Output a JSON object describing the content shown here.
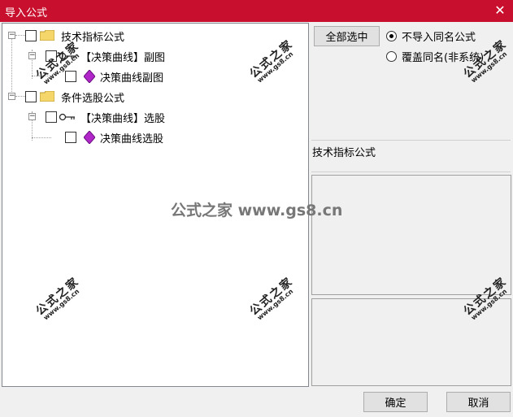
{
  "window": {
    "title": "导入公式",
    "close_glyph": "✕"
  },
  "tree": {
    "nodes": [
      {
        "label": "技术指标公式",
        "type": "folder",
        "expander": "−"
      },
      {
        "label": "【决策曲线】副图",
        "type": "key",
        "expander": "−"
      },
      {
        "label": "决策曲线副图",
        "type": "diamond"
      },
      {
        "label": "条件选股公式",
        "type": "folder",
        "expander": "−"
      },
      {
        "label": "【决策曲线】选股",
        "type": "key",
        "expander": "−"
      },
      {
        "label": "决策曲线选股",
        "type": "diamond"
      }
    ]
  },
  "right_panel": {
    "select_all_label": "全部选中",
    "radio_no_import_label": "不导入同名公式",
    "radio_overwrite_label": "覆盖同名(非系统)",
    "selected_radio": "no_import",
    "formula_type_label": "技术指标公式"
  },
  "footer": {
    "ok_label": "确定",
    "cancel_label": "取消"
  },
  "watermark": {
    "center_text": "公式之家 www.gs8.cn",
    "stamp_big": "公式之家",
    "stamp_small": "www.gs8.cn"
  },
  "colors": {
    "titlebar": "#c8102e",
    "folder": "#f5d66b",
    "diamond": "#b026c9"
  }
}
